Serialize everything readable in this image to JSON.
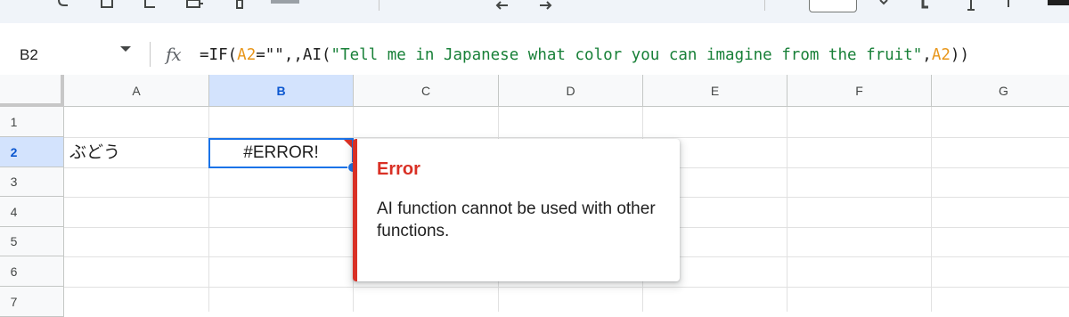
{
  "formula_bar": {
    "cell_ref": "B2",
    "fx_symbol": "fx",
    "formula": {
      "p1": "=IF(",
      "ref1": "A2",
      "p2": "=\"\",,AI(",
      "str": "\"Tell me in Japanese what color you can imagine from the fruit\"",
      "p3": ",",
      "ref2": "A2",
      "p4": "))"
    }
  },
  "grid": {
    "columns": [
      "A",
      "B",
      "C",
      "D",
      "E",
      "F",
      "G"
    ],
    "rows": [
      "1",
      "2",
      "3",
      "4",
      "5",
      "6",
      "7"
    ],
    "selected_column": "B",
    "selected_row": "2",
    "cells": {
      "A2": "ぶどう",
      "B2": "#ERROR!"
    }
  },
  "error_popup": {
    "title": "Error",
    "message": "AI function cannot be used with other functions."
  },
  "colors": {
    "accent": "#1a73e8",
    "error": "#d93025",
    "header_selected": "#d3e3fd",
    "formula_ref": "#e8961a",
    "formula_string": "#188038"
  }
}
